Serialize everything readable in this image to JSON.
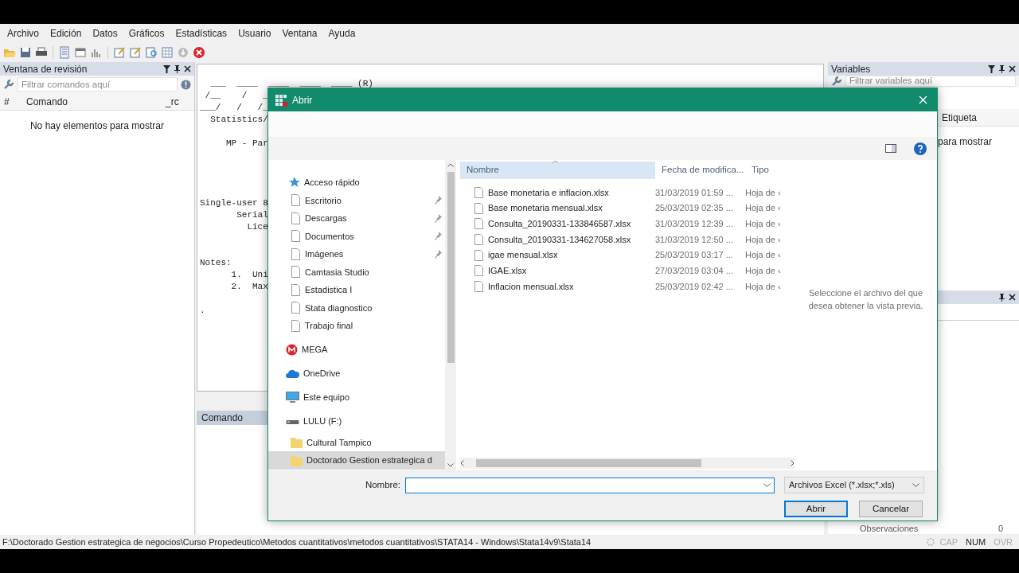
{
  "menu": [
    "Archivo",
    "Edición",
    "Datos",
    "Gráficos",
    "Estadísticas",
    "Usuario",
    "Ventana",
    "Ayuda"
  ],
  "review_pane": {
    "title": "Ventana de revisión",
    "filter_placeholder": "Filtrar comandos aquí",
    "columns": [
      "#",
      "Comando",
      "_rc"
    ],
    "empty_text": "No hay elementos para mostrar"
  },
  "results": {
    "blocks": [
      [
        "  ___  ____  ____  ____  ____ (R)",
        " /__    /   _",
        "___/   /   /_",
        "  Statistics/"
      ],
      [
        "     MP - Par"
      ],
      [
        "Single-user 8",
        "       Serial",
        "         Lice"
      ],
      [
        "Notes:",
        "      1.  Uni",
        "      2.  Max"
      ],
      [
        "."
      ]
    ]
  },
  "command_pane": {
    "title": "Comando"
  },
  "variables_pane": {
    "title": "Variables",
    "filter_placeholder": "Filtrar variables aquí",
    "column": "Etiqueta",
    "empty_text": "para mostrar"
  },
  "properties_pane": {
    "last_row": {
      "label": "Observaciones",
      "value": "0"
    }
  },
  "status_bar": {
    "path": "F:\\Doctorado Gestion estrategica de negocios\\Curso Propedeutico\\Metodos cuantitativos\\metodos cuantitativos\\STATA14 - Windows\\Stata14v9\\Stata14",
    "indicators": [
      {
        "label": "CAP",
        "on": false
      },
      {
        "label": "NUM",
        "on": true
      },
      {
        "label": "OVR",
        "on": false
      }
    ]
  },
  "dialog": {
    "title": "Abrir",
    "nav": [
      {
        "label": "Acceso rápido",
        "kind": "quick",
        "selected": false
      },
      {
        "label": "Escritorio",
        "kind": "pinned",
        "selected": false
      },
      {
        "label": "Descargas",
        "kind": "pinned",
        "selected": false
      },
      {
        "label": "Documentos",
        "kind": "pinned",
        "selected": false
      },
      {
        "label": "Imágenes",
        "kind": "pinned",
        "selected": false
      },
      {
        "label": "Camtasia Studio",
        "kind": "page",
        "selected": false
      },
      {
        "label": "Estadistica I",
        "kind": "page",
        "selected": false
      },
      {
        "label": "Stata diagnostico",
        "kind": "page",
        "selected": false
      },
      {
        "label": "Trabajo final",
        "kind": "page",
        "selected": false
      },
      {
        "label": "MEGA",
        "kind": "mega",
        "selected": false
      },
      {
        "label": "OneDrive",
        "kind": "cloud",
        "selected": false
      },
      {
        "label": "Este equipo",
        "kind": "computer",
        "selected": false
      },
      {
        "label": "LULU (F:)",
        "kind": "drive",
        "selected": false
      },
      {
        "label": "Cultural Tampico",
        "kind": "folder",
        "selected": false
      },
      {
        "label": "Doctorado Gestion estrategica d",
        "kind": "folder",
        "selected": true
      }
    ],
    "columns": [
      {
        "label": "Nombre",
        "hover": true
      },
      {
        "label": "Fecha de modifica...",
        "hover": false
      },
      {
        "label": "Tipo",
        "hover": false
      }
    ],
    "files": [
      {
        "name": "Base monetaria e inflacion.xlsx",
        "date": "31/03/2019 01:59 ...",
        "type": "Hoja de ‹"
      },
      {
        "name": "Base monetaria mensual.xlsx",
        "date": "25/03/2019 02:35 ...",
        "type": "Hoja de ‹"
      },
      {
        "name": "Consulta_20190331-133846587.xlsx",
        "date": "31/03/2019 12:39 ...",
        "type": "Hoja de ‹"
      },
      {
        "name": "Consulta_20190331-134627058.xlsx",
        "date": "31/03/2019 12:50 ...",
        "type": "Hoja de ‹"
      },
      {
        "name": "igae mensual.xlsx",
        "date": "25/03/2019 03:17 ...",
        "type": "Hoja de ‹"
      },
      {
        "name": "IGAE.xlsx",
        "date": "27/03/2019 03:04 ...",
        "type": "Hoja de ‹"
      },
      {
        "name": "Inflacion mensual.xlsx",
        "date": "25/03/2019 02:42 ...",
        "type": "Hoja de ‹"
      }
    ],
    "preview_hint": "Seleccione el archivo del que desea obtener la vista previa.",
    "filename_label": "Nombre:",
    "filetype": "Archivos Excel (*.xlsx;*.xls)",
    "buttons": [
      {
        "label": "Abrir",
        "default": true
      },
      {
        "label": "Cancelar",
        "default": false
      }
    ]
  }
}
